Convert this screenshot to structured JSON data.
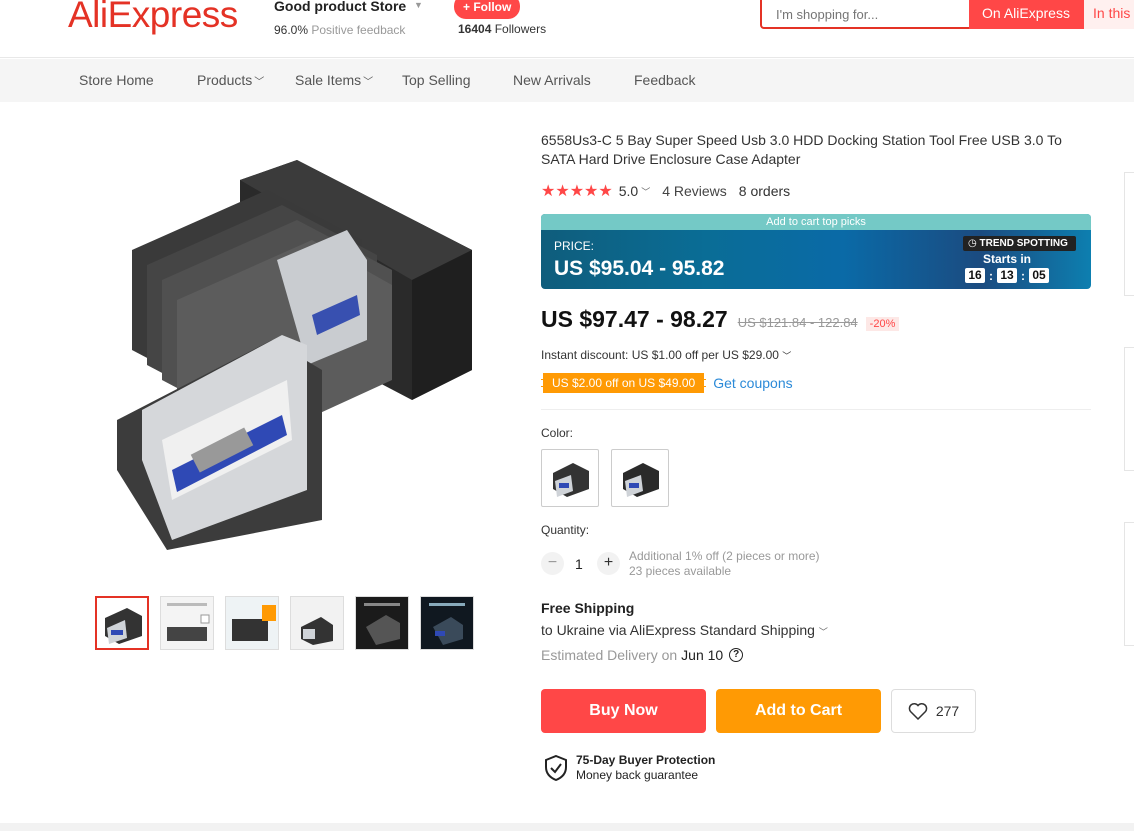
{
  "header": {
    "logo": "AliExpress",
    "store_name": "Good product Store",
    "positive_pct": "96.0%",
    "positive_label": "Positive feedback",
    "follow_label": "+ Follow",
    "followers_count": "16404",
    "followers_label": "Followers",
    "search_placeholder": "I'm shopping for...",
    "search_aliexpress": "On AliExpress",
    "search_store": "In this"
  },
  "nav": {
    "items": [
      "Store Home",
      "Products",
      "Sale Items",
      "Top Selling",
      "New Arrivals",
      "Feedback"
    ]
  },
  "product": {
    "title": "6558Us3-C 5 Bay Super Speed Usb 3.0 HDD Docking Station Tool Free USB 3.0 To SATA Hard Drive Enclosure Case Adapter",
    "rating": "5.0",
    "reviews": "4 Reviews",
    "orders": "8 orders",
    "promo": {
      "top_label": "Add to cart top picks",
      "price_label": "PRICE:",
      "price": "US $95.04 - 95.82",
      "tag": "TREND SPOTTING",
      "starts_in": "Starts in",
      "hours": "16",
      "minutes": "13",
      "seconds": "05"
    },
    "price": "US $97.47 - 98.27",
    "old_price": "US $121.84 - 122.84",
    "discount": "-20%",
    "instant_discount": "Instant discount: US $1.00 off per US $29.00",
    "coupon": "US $2.00 off on US $49.00",
    "get_coupons": "Get coupons",
    "color_label": "Color:",
    "quantity_label": "Quantity:",
    "quantity": "1",
    "qty_note_1": "Additional 1% off (2 pieces or more)",
    "qty_note_2": "23 pieces available",
    "shipping_title": "Free Shipping",
    "shipping_line": "to Ukraine via AliExpress Standard Shipping",
    "delivery_label": "Estimated Delivery on",
    "delivery_date": "Jun 10",
    "buy_now": "Buy Now",
    "add_to_cart": "Add to Cart",
    "wishlist_count": "277",
    "protection_title": "75-Day Buyer Protection",
    "protection_sub": "Money back guarantee"
  },
  "colors": {
    "accent": "#ff4747",
    "orange": "#ff9a04",
    "link": "#2b8ad8"
  }
}
